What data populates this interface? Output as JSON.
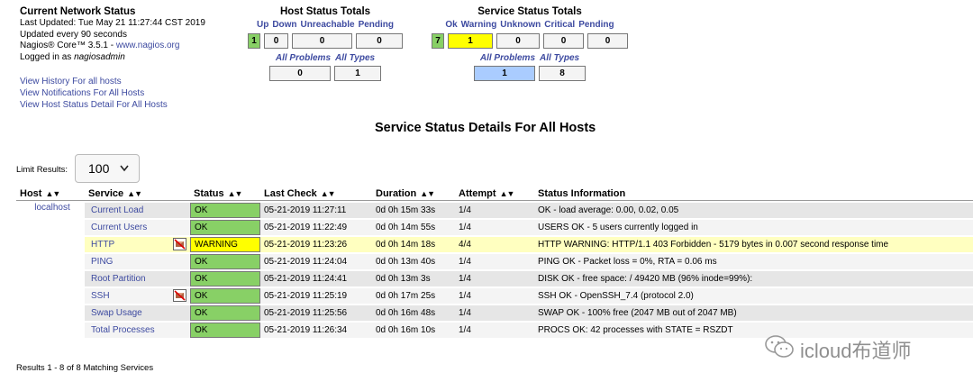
{
  "info": {
    "title": "Current Network Status",
    "last_updated": "Last Updated: Tue May 21 11:27:44 CST 2019",
    "update_interval": "Updated every 90 seconds",
    "version_prefix": "Nagios® Core™ 3.5.1 - ",
    "version_link": "www.nagios.org",
    "logged_in_prefix": "Logged in as ",
    "user": "nagiosadmin",
    "links": [
      "View History For all hosts",
      "View Notifications For All Hosts",
      "View Host Status Detail For All Hosts"
    ]
  },
  "host_totals": {
    "title": "Host Status Totals",
    "headers": [
      "Up",
      "Down",
      "Unreachable",
      "Pending"
    ],
    "values": [
      "1",
      "0",
      "0",
      "0"
    ],
    "problems_label": "All Problems",
    "types_label": "All Types",
    "problems": "0",
    "types": "1"
  },
  "service_totals": {
    "title": "Service Status Totals",
    "headers": [
      "Ok",
      "Warning",
      "Unknown",
      "Critical",
      "Pending"
    ],
    "values": [
      "7",
      "1",
      "0",
      "0",
      "0"
    ],
    "problems_label": "All Problems",
    "types_label": "All Types",
    "problems": "1",
    "types": "8"
  },
  "section_title": "Service Status Details For All Hosts",
  "limit": {
    "label": "Limit Results:",
    "value": "100"
  },
  "table": {
    "columns": [
      "Host",
      "Service",
      "Status",
      "Last Check",
      "Duration",
      "Attempt",
      "Status Information"
    ],
    "host": "localhost",
    "rows": [
      {
        "service": "Current Load",
        "status": "OK",
        "last_check": "05-21-2019 11:27:11",
        "duration": "0d 0h 15m 33s",
        "attempt": "1/4",
        "info": "OK - load average: 0.00, 0.02, 0.05"
      },
      {
        "service": "Current Users",
        "status": "OK",
        "last_check": "05-21-2019 11:22:49",
        "duration": "0d 0h 14m 55s",
        "attempt": "1/4",
        "info": "USERS OK - 5 users currently logged in"
      },
      {
        "service": "HTTP",
        "status": "WARNING",
        "last_check": "05-21-2019 11:23:26",
        "duration": "0d 0h 14m 18s",
        "attempt": "4/4",
        "info": "HTTP WARNING: HTTP/1.1 403 Forbidden - 5179 bytes in 0.007 second response time"
      },
      {
        "service": "PING",
        "status": "OK",
        "last_check": "05-21-2019 11:24:04",
        "duration": "0d 0h 13m 40s",
        "attempt": "1/4",
        "info": "PING OK - Packet loss = 0%, RTA = 0.06 ms"
      },
      {
        "service": "Root Partition",
        "status": "OK",
        "last_check": "05-21-2019 11:24:41",
        "duration": "0d 0h 13m 3s",
        "attempt": "1/4",
        "info": "DISK OK - free space: / 49420 MB (96% inode=99%):"
      },
      {
        "service": "SSH",
        "status": "OK",
        "last_check": "05-21-2019 11:25:19",
        "duration": "0d 0h 17m 25s",
        "attempt": "1/4",
        "info": "SSH OK - OpenSSH_7.4 (protocol 2.0)"
      },
      {
        "service": "Swap Usage",
        "status": "OK",
        "last_check": "05-21-2019 11:25:56",
        "duration": "0d 0h 16m 48s",
        "attempt": "1/4",
        "info": "SWAP OK - 100% free (2047 MB out of 2047 MB)"
      },
      {
        "service": "Total Processes",
        "status": "OK",
        "last_check": "05-21-2019 11:26:34",
        "duration": "0d 0h 16m 10s",
        "attempt": "1/4",
        "info": "PROCS OK: 42 processes with STATE = RSZDT"
      }
    ]
  },
  "results_text": "Results 1 - 8 of 8 Matching Services",
  "watermark": "icloud布道师",
  "colors": {
    "ok": "#88d066",
    "warning": "#ffff00",
    "warning_row": "#ffffc0",
    "link": "#3d4aa0",
    "problems_highlight": "#aaccff"
  },
  "icons": {
    "sort": "sort-arrows-icon",
    "notifications_disabled": "notifications-disabled-icon",
    "dropdown": "chevron-down-icon",
    "watermark": "wechat-icon"
  }
}
